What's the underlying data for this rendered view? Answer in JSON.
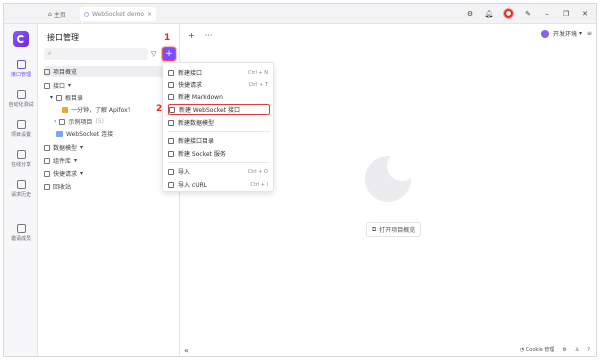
{
  "tabs": {
    "home": "主页",
    "active": "WebSocket demo"
  },
  "sidebar": {
    "items": [
      {
        "label": "接口管理",
        "icon": "api-icon"
      },
      {
        "label": "自动化测试",
        "icon": "test-icon"
      },
      {
        "label": "项目设置",
        "icon": "settings-icon"
      },
      {
        "label": "在线分享",
        "icon": "share-icon"
      },
      {
        "label": "请求历史",
        "icon": "history-icon"
      },
      {
        "label": "邀请成员",
        "icon": "invite-icon"
      }
    ]
  },
  "tree": {
    "title": "接口管理",
    "search_placeholder": "",
    "rows": {
      "overview": "项目概览",
      "api": "接口",
      "root": "根目录",
      "apifox": "一分钟，了解 Apifox！",
      "example": "示例项目",
      "example_count": "(5)",
      "ws": "WebSocket 连接",
      "model": "数据模型",
      "components": "组件库",
      "quick": "快捷请求",
      "recycle": "回收站"
    }
  },
  "main": {
    "plus": "+",
    "more": "···",
    "env_label": "开发环境",
    "open_overview": "打开项目概览",
    "collapse": "«",
    "cookie": "Cookie 管理"
  },
  "menu": {
    "items": [
      {
        "label": "新建接口",
        "shortcut": "Ctrl + N"
      },
      {
        "label": "快捷请求",
        "shortcut": "Ctrl + T"
      },
      {
        "label": "新建 Markdown",
        "shortcut": ""
      },
      {
        "label": "新建 WebSocket 接口",
        "shortcut": ""
      },
      {
        "label": "新建数据模型",
        "shortcut": ""
      },
      {
        "label": "新建接口目录",
        "shortcut": ""
      },
      {
        "label": "新建 Socket 服务",
        "shortcut": ""
      },
      {
        "label": "导入",
        "shortcut": "Ctrl + O"
      },
      {
        "label": "导入 cURL",
        "shortcut": "Ctrl + I"
      }
    ]
  },
  "annotations": {
    "step1": "1",
    "step2": "2"
  },
  "colors": {
    "accent": "#7c4dff",
    "highlight": "#e03b3b"
  }
}
